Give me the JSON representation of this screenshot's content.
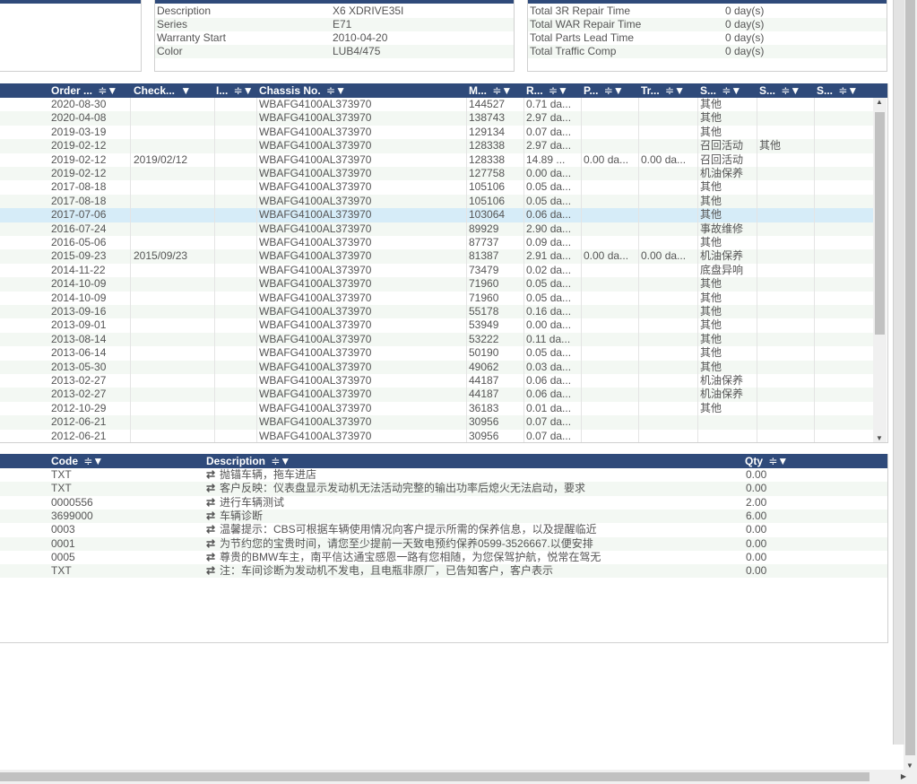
{
  "vehicle_info": {
    "rows": [
      {
        "label": "Description",
        "value": "X6 XDRIVE35I"
      },
      {
        "label": "Series",
        "value": "E71"
      },
      {
        "label": "Warranty Start",
        "value": "2010-04-20"
      },
      {
        "label": "Color",
        "value": "LUB4/475"
      }
    ]
  },
  "time_info": {
    "rows": [
      {
        "label": "Total 3R Repair Time",
        "value": "0 day(s)"
      },
      {
        "label": "Total WAR Repair Time",
        "value": "0 day(s)"
      },
      {
        "label": "Total Parts Lead Time",
        "value": "0 day(s)"
      },
      {
        "label": "Total Traffic Comp",
        "value": "0 day(s)"
      }
    ]
  },
  "orders": {
    "columns": [
      "Order ...",
      "Check...",
      "I...",
      "Chassis No.",
      "M...",
      "R...",
      "P...",
      "Tr...",
      "S...",
      "S...",
      "S..."
    ],
    "rows": [
      [
        "2020-08-30",
        "",
        "WBAFG4100AL373970",
        "144527",
        "0.71 da...",
        "",
        "",
        "其他",
        ""
      ],
      [
        "2020-04-08",
        "",
        "WBAFG4100AL373970",
        "138743",
        "2.97 da...",
        "",
        "",
        "其他",
        ""
      ],
      [
        "2019-03-19",
        "",
        "WBAFG4100AL373970",
        "129134",
        "0.07 da...",
        "",
        "",
        "其他",
        ""
      ],
      [
        "2019-02-12",
        "",
        "WBAFG4100AL373970",
        "128338",
        "2.97 da...",
        "",
        "",
        "召回活动",
        "其他"
      ],
      [
        "2019-02-12",
        "2019/02/12",
        "WBAFG4100AL373970",
        "128338",
        "14.89 ...",
        "0.00 da...",
        "0.00 da...",
        "召回活动",
        ""
      ],
      [
        "2019-02-12",
        "",
        "WBAFG4100AL373970",
        "127758",
        "0.00 da...",
        "",
        "",
        "机油保养",
        ""
      ],
      [
        "2017-08-18",
        "",
        "WBAFG4100AL373970",
        "105106",
        "0.05 da...",
        "",
        "",
        "其他",
        ""
      ],
      [
        "2017-08-18",
        "",
        "WBAFG4100AL373970",
        "105106",
        "0.05 da...",
        "",
        "",
        "其他",
        ""
      ],
      [
        "2017-07-06",
        "",
        "WBAFG4100AL373970",
        "103064",
        "0.06 da...",
        "",
        "",
        "其他",
        ""
      ],
      [
        "2016-07-24",
        "",
        "WBAFG4100AL373970",
        "89929",
        "2.90 da...",
        "",
        "",
        "事故维修",
        ""
      ],
      [
        "2016-05-06",
        "",
        "WBAFG4100AL373970",
        "87737",
        "0.09 da...",
        "",
        "",
        "其他",
        ""
      ],
      [
        "2015-09-23",
        "2015/09/23",
        "WBAFG4100AL373970",
        "81387",
        "2.91 da...",
        "0.00 da...",
        "0.00 da...",
        "机油保养",
        ""
      ],
      [
        "2014-11-22",
        "",
        "WBAFG4100AL373970",
        "73479",
        "0.02 da...",
        "",
        "",
        "底盘异响",
        ""
      ],
      [
        "2014-10-09",
        "",
        "WBAFG4100AL373970",
        "71960",
        "0.05 da...",
        "",
        "",
        "其他",
        ""
      ],
      [
        "2014-10-09",
        "",
        "WBAFG4100AL373970",
        "71960",
        "0.05 da...",
        "",
        "",
        "其他",
        ""
      ],
      [
        "2013-09-16",
        "",
        "WBAFG4100AL373970",
        "55178",
        "0.16 da...",
        "",
        "",
        "其他",
        ""
      ],
      [
        "2013-09-01",
        "",
        "WBAFG4100AL373970",
        "53949",
        "0.00 da...",
        "",
        "",
        "其他",
        ""
      ],
      [
        "2013-08-14",
        "",
        "WBAFG4100AL373970",
        "53222",
        "0.11 da...",
        "",
        "",
        "其他",
        ""
      ],
      [
        "2013-06-14",
        "",
        "WBAFG4100AL373970",
        "50190",
        "0.05 da...",
        "",
        "",
        "其他",
        ""
      ],
      [
        "2013-05-30",
        "",
        "WBAFG4100AL373970",
        "49062",
        "0.03 da...",
        "",
        "",
        "其他",
        ""
      ],
      [
        "2013-02-27",
        "",
        "WBAFG4100AL373970",
        "44187",
        "0.06 da...",
        "",
        "",
        "机油保养",
        ""
      ],
      [
        "2013-02-27",
        "",
        "WBAFG4100AL373970",
        "44187",
        "0.06 da...",
        "",
        "",
        "机油保养",
        ""
      ],
      [
        "2012-10-29",
        "",
        "WBAFG4100AL373970",
        "36183",
        "0.01 da...",
        "",
        "",
        "其他",
        ""
      ],
      [
        "2012-06-21",
        "",
        "WBAFG4100AL373970",
        "30956",
        "0.07 da...",
        "",
        "",
        "",
        ""
      ],
      [
        "2012-06-21",
        "",
        "WBAFG4100AL373970",
        "30956",
        "0.07 da...",
        "",
        "",
        "",
        ""
      ]
    ],
    "selected_row": 8
  },
  "details": {
    "columns": [
      "Code",
      "Description",
      "Qty"
    ],
    "swap_icon": "⇄",
    "rows": [
      [
        "TXT",
        "抛锚车辆，拖车进店",
        "0.00"
      ],
      [
        "TXT",
        "客户反映：仪表盘显示发动机无法活动完整的输出功率后熄火无法启动，要求",
        "0.00"
      ],
      [
        "0000556",
        "进行车辆测试",
        "2.00"
      ],
      [
        "3699000",
        "车辆诊断",
        "6.00"
      ],
      [
        "0003",
        "温馨提示：CBS可根据车辆使用情况向客户提示所需的保养信息，以及提醒临近",
        "0.00"
      ],
      [
        "0001",
        "为节约您的宝贵时间，请您至少提前一天致电预约保养0599-3526667.以便安排",
        "0.00"
      ],
      [
        "0005",
        "尊贵的BMW车主，南平信达通宝感恩一路有您相随，为您保驾护航，悦常在驾无",
        "0.00"
      ],
      [
        "TXT",
        "注：车间诊断为发动机不发电，且电瓶非原厂，已告知客户，客户表示",
        "0.00"
      ]
    ]
  },
  "icons": {
    "sort": "sort-icon",
    "filter": "filter-icon"
  },
  "colors": {
    "header": "#2f4a7a",
    "alt_row": "#f3f8f3",
    "selected_row": "#d6ecf8"
  }
}
